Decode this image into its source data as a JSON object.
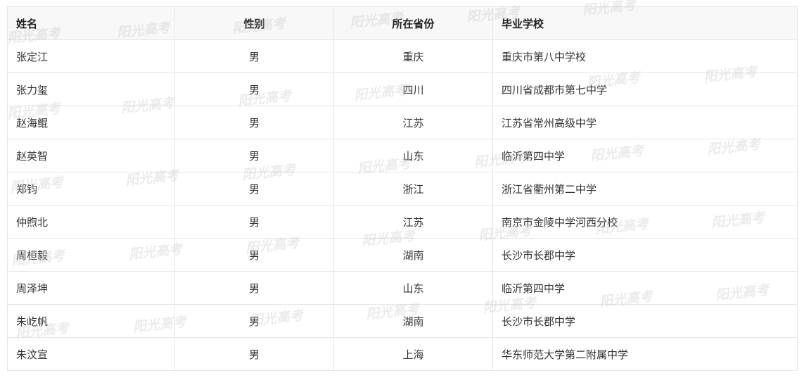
{
  "watermark": {
    "text": "阳光高考",
    "color": "#bebebe"
  },
  "table": {
    "headers": {
      "name": "姓名",
      "gender": "性别",
      "province": "所在省份",
      "school": "毕业学校"
    },
    "rows": [
      {
        "name": "张定江",
        "gender": "男",
        "province": "重庆",
        "school": "重庆市第八中学校"
      },
      {
        "name": "张力玺",
        "gender": "男",
        "province": "四川",
        "school": "四川省成都市第七中学"
      },
      {
        "name": "赵海鲲",
        "gender": "男",
        "province": "江苏",
        "school": "江苏省常州高级中学"
      },
      {
        "name": "赵英智",
        "gender": "男",
        "province": "山东",
        "school": "临沂第四中学"
      },
      {
        "name": "郑钧",
        "gender": "男",
        "province": "浙江",
        "school": "浙江省衢州第二中学"
      },
      {
        "name": "仲煦北",
        "gender": "男",
        "province": "江苏",
        "school": "南京市金陵中学河西分校"
      },
      {
        "name": "周桓毅",
        "gender": "男",
        "province": "湖南",
        "school": "长沙市长郡中学"
      },
      {
        "name": "周泽坤",
        "gender": "男",
        "province": "山东",
        "school": "临沂第四中学"
      },
      {
        "name": "朱屹帆",
        "gender": "男",
        "province": "湖南",
        "school": "长沙市长郡中学"
      },
      {
        "name": "朱汶宣",
        "gender": "男",
        "province": "上海",
        "school": "华东师范大学第二附属中学"
      }
    ]
  }
}
